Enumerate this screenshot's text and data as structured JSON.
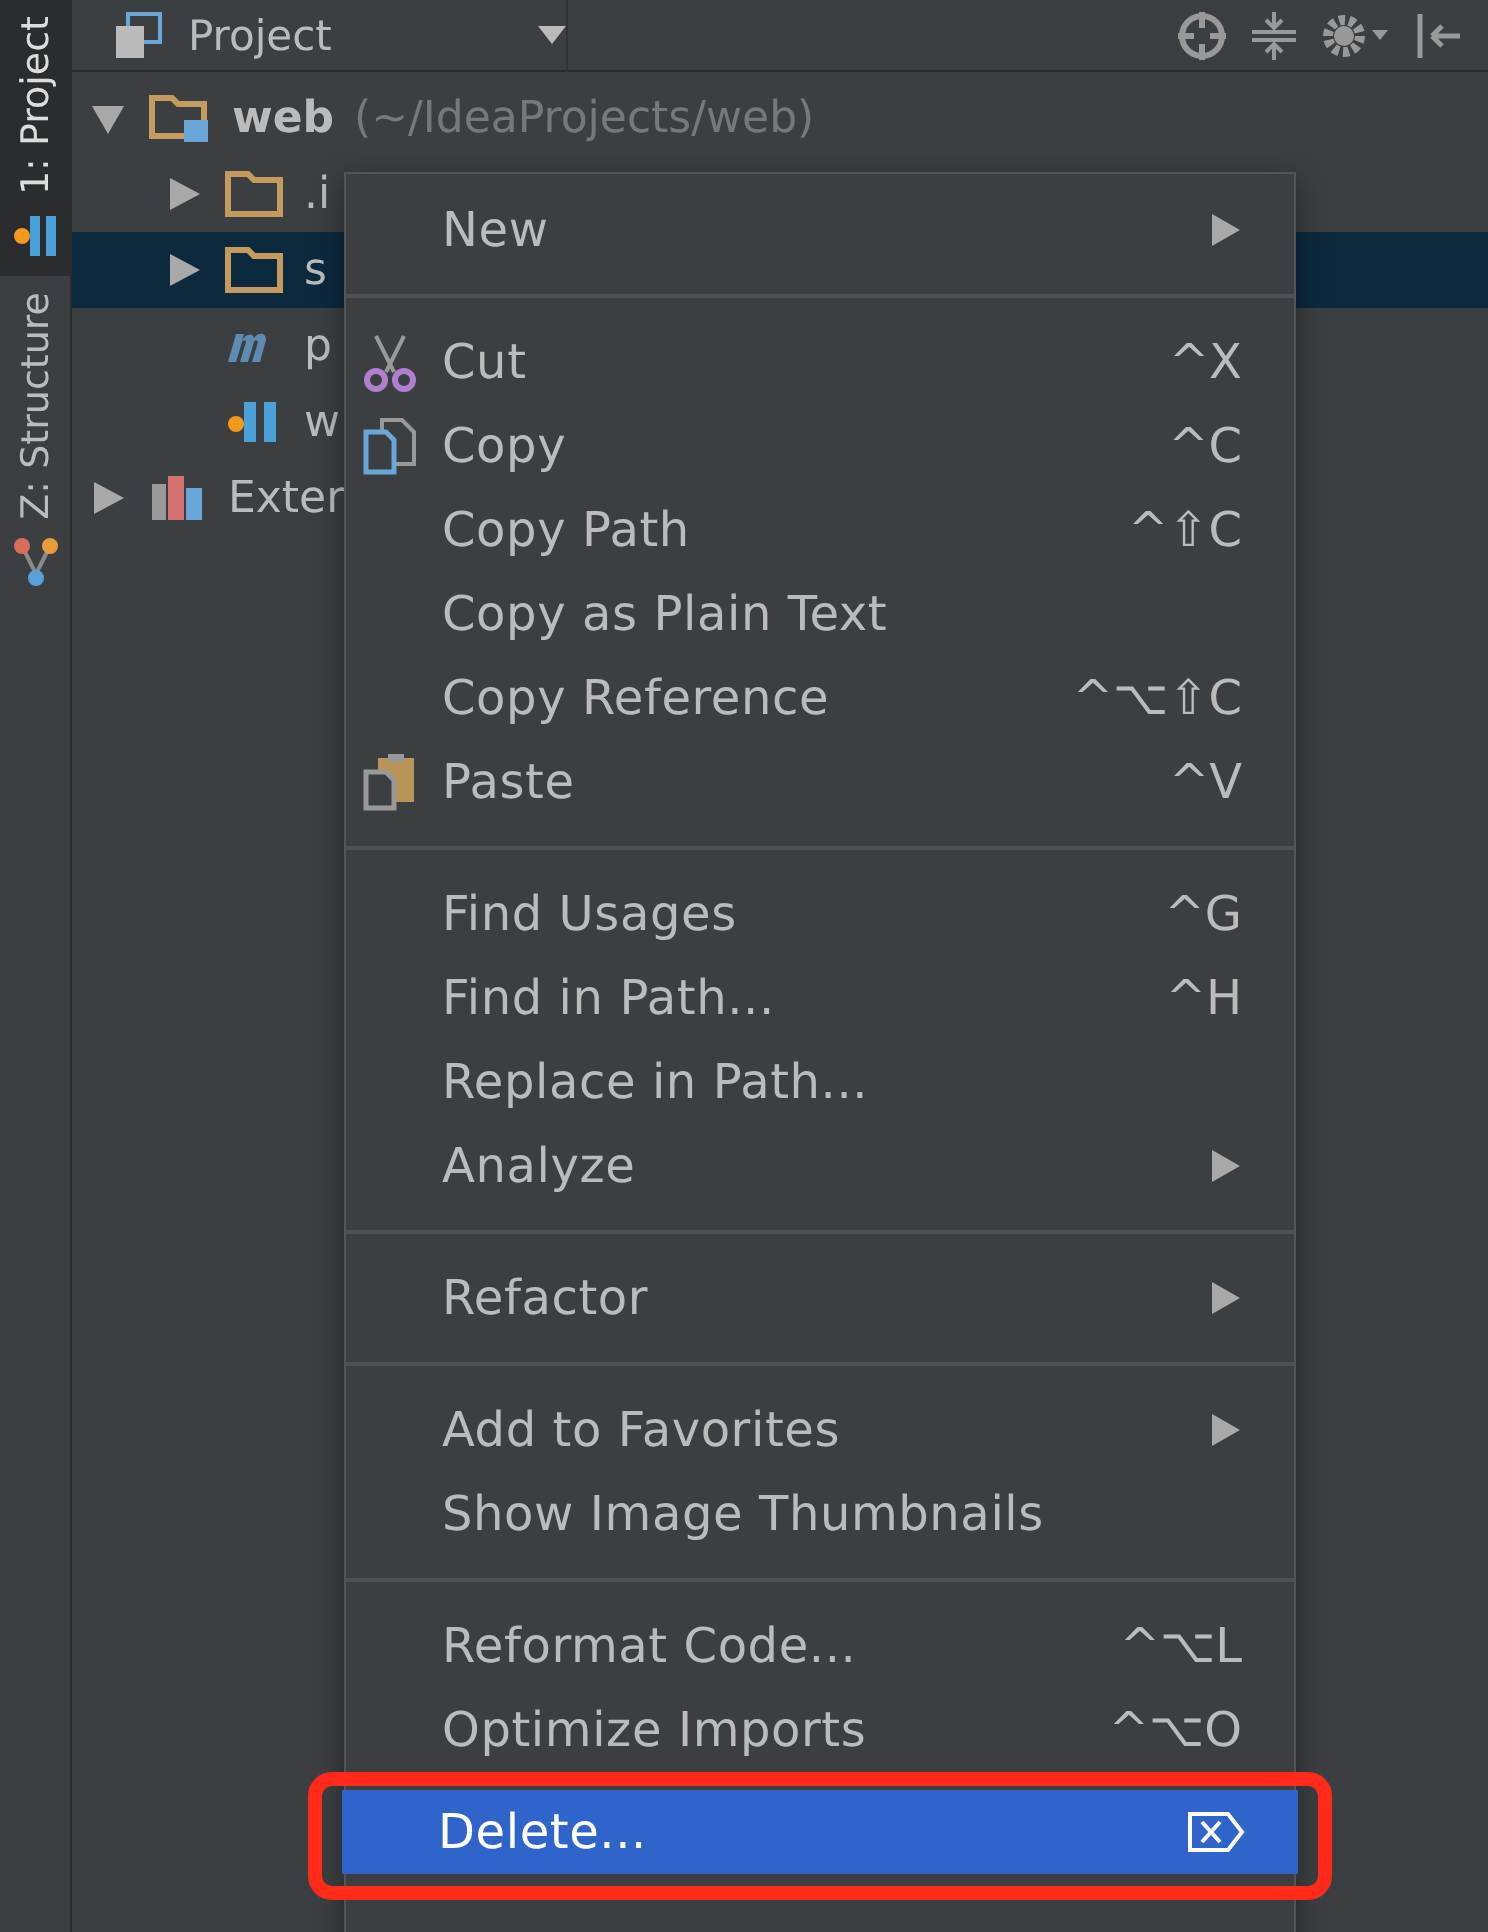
{
  "tool_stripe": [
    {
      "label": "1: Project",
      "selected": true
    },
    {
      "label": "Z: Structure",
      "selected": false
    }
  ],
  "header": {
    "view": "Project"
  },
  "tree": [
    {
      "name": "web",
      "path": "(~/IdeaProjects/web)",
      "kind": "module",
      "expanded": true,
      "selected": false,
      "children": [
        {
          "name": ".i",
          "kind": "folder",
          "expanded": false,
          "selected": false
        },
        {
          "name": "s",
          "kind": "folder",
          "expanded": false,
          "selected": true
        },
        {
          "name": "p",
          "kind": "maven",
          "selected": false
        },
        {
          "name": "w",
          "kind": "iml",
          "selected": false
        }
      ]
    },
    {
      "name": "Exter",
      "kind": "library",
      "expanded": false,
      "selected": false
    }
  ],
  "menu": [
    {
      "kind": "item",
      "label": "New",
      "submenu": true,
      "selected": false
    },
    {
      "kind": "separator"
    },
    {
      "kind": "cut",
      "label": "Cut",
      "shortcut": "^X",
      "selected": false
    },
    {
      "kind": "copy",
      "label": "Copy",
      "shortcut": "^C",
      "selected": false
    },
    {
      "kind": "item",
      "label": "Copy Path",
      "shortcut": "^⇧C",
      "selected": false
    },
    {
      "kind": "item",
      "label": "Copy as Plain Text",
      "selected": false
    },
    {
      "kind": "item",
      "label": "Copy Reference",
      "shortcut": "^⌥⇧C",
      "selected": false
    },
    {
      "kind": "paste",
      "label": "Paste",
      "shortcut": "^V",
      "selected": false
    },
    {
      "kind": "separator"
    },
    {
      "kind": "item",
      "label": "Find Usages",
      "shortcut": "^G",
      "selected": false
    },
    {
      "kind": "item",
      "label": "Find in Path...",
      "shortcut": "^H",
      "selected": false
    },
    {
      "kind": "item",
      "label": "Replace in Path...",
      "selected": false
    },
    {
      "kind": "item",
      "label": "Analyze",
      "submenu": true,
      "selected": false
    },
    {
      "kind": "separator"
    },
    {
      "kind": "item",
      "label": "Refactor",
      "submenu": true,
      "selected": false
    },
    {
      "kind": "separator"
    },
    {
      "kind": "item",
      "label": "Add to Favorites",
      "submenu": true,
      "selected": false
    },
    {
      "kind": "item",
      "label": "Show Image Thumbnails",
      "selected": false
    },
    {
      "kind": "separator"
    },
    {
      "kind": "item",
      "label": "Reformat Code...",
      "shortcut": "^⌥L",
      "selected": false
    },
    {
      "kind": "item",
      "label": "Optimize Imports",
      "shortcut": "^⌥O",
      "selected": false
    },
    {
      "kind": "delete",
      "label": "Delete...",
      "selected": true,
      "annotated": true
    }
  ]
}
